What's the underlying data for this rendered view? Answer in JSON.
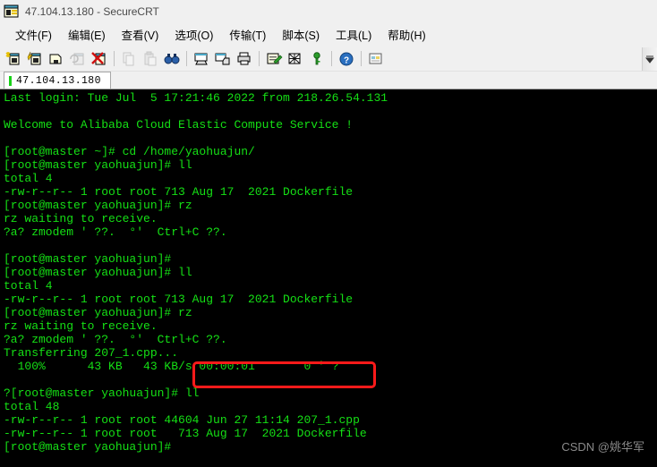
{
  "window": {
    "title": "47.104.13.180 - SecureCRT",
    "icon": "securecrt-terminal-icon"
  },
  "menubar": {
    "items": [
      {
        "label": "文件(F)",
        "name": "file"
      },
      {
        "label": "编辑(E)",
        "name": "edit"
      },
      {
        "label": "查看(V)",
        "name": "view"
      },
      {
        "label": "选项(O)",
        "name": "options"
      },
      {
        "label": "传输(T)",
        "name": "transfer"
      },
      {
        "label": "脚本(S)",
        "name": "script"
      },
      {
        "label": "工具(L)",
        "name": "tools"
      },
      {
        "label": "帮助(H)",
        "name": "help"
      }
    ]
  },
  "toolbar": {
    "buttons": [
      {
        "name": "new-session-icon",
        "glyph": "✳",
        "enabled": true
      },
      {
        "name": "connect-icon",
        "glyph": "⚡",
        "enabled": true
      },
      {
        "name": "connect-local-shell-icon",
        "glyph": "▭",
        "enabled": true
      },
      {
        "name": "reconnect-icon",
        "glyph": "↻",
        "enabled": false
      },
      {
        "name": "disconnect-icon",
        "glyph": "✖",
        "enabled": true
      },
      {
        "name": "copy-icon",
        "glyph": "❐",
        "enabled": false
      },
      {
        "name": "paste-icon",
        "glyph": "📋",
        "enabled": false
      },
      {
        "name": "find-icon",
        "glyph": "🔍",
        "enabled": true
      },
      {
        "name": "print-screen-icon",
        "glyph": "🖶",
        "enabled": true
      },
      {
        "name": "log-session-icon",
        "glyph": "▤",
        "enabled": true
      },
      {
        "name": "print-icon",
        "glyph": "🖨",
        "enabled": true
      },
      {
        "name": "session-options-icon",
        "glyph": "✎",
        "enabled": true
      },
      {
        "name": "global-options-icon",
        "glyph": "✕",
        "enabled": true
      },
      {
        "name": "key-icon",
        "glyph": "🔑",
        "enabled": true
      },
      {
        "name": "help-icon",
        "glyph": "?",
        "enabled": true
      },
      {
        "name": "tile-windows-icon",
        "glyph": "▩",
        "enabled": true
      }
    ],
    "overflow_label": "toolbar-overflow-chevron"
  },
  "tabs": [
    {
      "label": "47.104.13.180",
      "active": true,
      "indicator_color": "#17d117"
    }
  ],
  "terminal": {
    "foreground": "#15e015",
    "background": "#000000",
    "lines": [
      "Last login: Tue Jul  5 17:21:46 2022 from 218.26.54.131",
      "",
      "Welcome to Alibaba Cloud Elastic Compute Service !",
      "",
      "[root@master ~]# cd /home/yaohuajun/",
      "[root@master yaohuajun]# ll",
      "total 4",
      "-rw-r--r-- 1 root root 713 Aug 17  2021 Dockerfile",
      "[root@master yaohuajun]# rz",
      "rz waiting to receive.",
      "?a? zmodem ' ??.  °'  Ctrl+C ??.",
      "",
      "[root@master yaohuajun]#",
      "[root@master yaohuajun]# ll",
      "total 4",
      "-rw-r--r-- 1 root root 713 Aug 17  2021 Dockerfile",
      "[root@master yaohuajun]# rz",
      "rz waiting to receive.",
      "?a? zmodem ' ??.  °'  Ctrl+C ??.",
      "Transferring 207_1.cpp...",
      "  100%      43 KB   43 KB/s 00:00:01       0 ' ?",
      "",
      "?[root@master yaohuajun]# ll",
      "total 48",
      "-rw-r--r-- 1 root root 44604 Jun 27 11:14 207_1.cpp",
      "-rw-r--r-- 1 root root   713 Aug 17  2021 Dockerfile",
      "[root@master yaohuajun]#"
    ]
  },
  "annotation": {
    "name": "red-highlight-box",
    "color": "#ff1a1a",
    "highlighted_text": "44604 Jun 27 11:14 207_1.cpp"
  },
  "watermark": {
    "text": "CSDN @姚华军"
  }
}
